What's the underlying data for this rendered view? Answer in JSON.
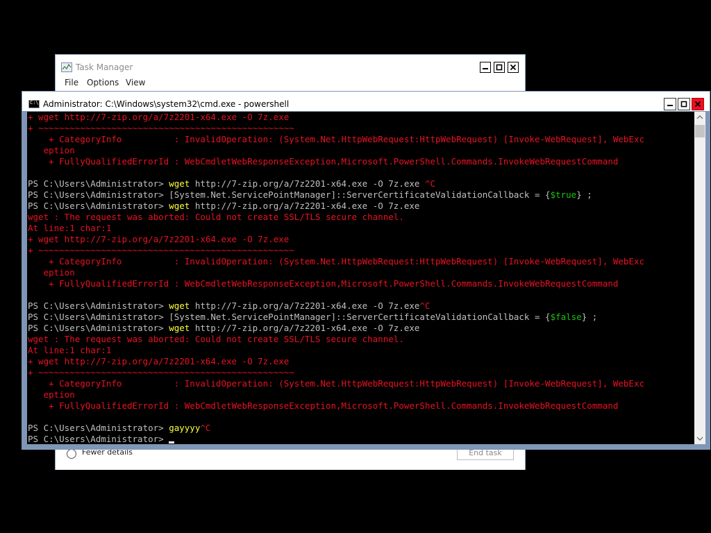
{
  "task_manager": {
    "title": "Task Manager",
    "menu": [
      "File",
      "Options",
      "View"
    ],
    "fewer_details": "Fewer details",
    "end_task": "End task"
  },
  "console": {
    "title": "Administrator: C:\\Windows\\system32\\cmd.exe - powershell",
    "icon_label": "C:\\",
    "lines": [
      [
        {
          "t": "+ wget http://7-zip.org/a/7z2201-x64.exe -O 7z.exe",
          "c": "r"
        }
      ],
      [
        {
          "t": "+ ~~~~~~~~~~~~~~~~~~~~~~~~~~~~~~~~~~~~~~~~~~~~~~~~~",
          "c": "r"
        }
      ],
      [
        {
          "t": "    + CategoryInfo          : InvalidOperation: (System.Net.HttpWebRequest:HttpWebRequest) [Invoke-WebRequest], WebExc",
          "c": "r"
        }
      ],
      [
        {
          "t": "   eption",
          "c": "r"
        }
      ],
      [
        {
          "t": "    + FullyQualifiedErrorId : WebCmdletWebResponseException,Microsoft.PowerShell.Commands.InvokeWebRequestCommand",
          "c": "r"
        }
      ],
      [
        {
          "t": "",
          "c": "w"
        }
      ],
      [
        {
          "t": "PS C:\\Users\\Administrator> ",
          "c": "w"
        },
        {
          "t": "wget",
          "c": "y"
        },
        {
          "t": " http://7-zip.org/a/7z2201-x64.exe -O 7z.exe ",
          "c": "w"
        },
        {
          "t": "^C",
          "c": "r"
        }
      ],
      [
        {
          "t": "PS C:\\Users\\Administrator> [System.Net.ServicePointManager]::ServerCertificateValidationCallback = {",
          "c": "w"
        },
        {
          "t": "$true",
          "c": "g"
        },
        {
          "t": "} ;",
          "c": "w"
        }
      ],
      [
        {
          "t": "PS C:\\Users\\Administrator> ",
          "c": "w"
        },
        {
          "t": "wget",
          "c": "y"
        },
        {
          "t": " http://7-zip.org/a/7z2201-x64.exe -O 7z.exe",
          "c": "w"
        }
      ],
      [
        {
          "t": "wget : The request was aborted: Could not create SSL/TLS secure channel.",
          "c": "r"
        }
      ],
      [
        {
          "t": "At line:1 char:1",
          "c": "r"
        }
      ],
      [
        {
          "t": "+ wget http://7-zip.org/a/7z2201-x64.exe -O 7z.exe",
          "c": "r"
        }
      ],
      [
        {
          "t": "+ ~~~~~~~~~~~~~~~~~~~~~~~~~~~~~~~~~~~~~~~~~~~~~~~~~",
          "c": "r"
        }
      ],
      [
        {
          "t": "    + CategoryInfo          : InvalidOperation: (System.Net.HttpWebRequest:HttpWebRequest) [Invoke-WebRequest], WebExc",
          "c": "r"
        }
      ],
      [
        {
          "t": "   eption",
          "c": "r"
        }
      ],
      [
        {
          "t": "    + FullyQualifiedErrorId : WebCmdletWebResponseException,Microsoft.PowerShell.Commands.InvokeWebRequestCommand",
          "c": "r"
        }
      ],
      [
        {
          "t": "",
          "c": "w"
        }
      ],
      [
        {
          "t": "PS C:\\Users\\Administrator> ",
          "c": "w"
        },
        {
          "t": "wget",
          "c": "y"
        },
        {
          "t": " http://7-zip.org/a/7z2201-x64.exe -O 7z.exe",
          "c": "w"
        },
        {
          "t": "^C",
          "c": "r"
        }
      ],
      [
        {
          "t": "PS C:\\Users\\Administrator> [System.Net.ServicePointManager]::ServerCertificateValidationCallback = {",
          "c": "w"
        },
        {
          "t": "$false",
          "c": "g"
        },
        {
          "t": "} ;",
          "c": "w"
        }
      ],
      [
        {
          "t": "PS C:\\Users\\Administrator> ",
          "c": "w"
        },
        {
          "t": "wget",
          "c": "y"
        },
        {
          "t": " http://7-zip.org/a/7z2201-x64.exe -O 7z.exe",
          "c": "w"
        }
      ],
      [
        {
          "t": "wget : The request was aborted: Could not create SSL/TLS secure channel.",
          "c": "r"
        }
      ],
      [
        {
          "t": "At line:1 char:1",
          "c": "r"
        }
      ],
      [
        {
          "t": "+ wget http://7-zip.org/a/7z2201-x64.exe -O 7z.exe",
          "c": "r"
        }
      ],
      [
        {
          "t": "+ ~~~~~~~~~~~~~~~~~~~~~~~~~~~~~~~~~~~~~~~~~~~~~~~~~",
          "c": "r"
        }
      ],
      [
        {
          "t": "    + CategoryInfo          : InvalidOperation: (System.Net.HttpWebRequest:HttpWebRequest) [Invoke-WebRequest], WebExc",
          "c": "r"
        }
      ],
      [
        {
          "t": "   eption",
          "c": "r"
        }
      ],
      [
        {
          "t": "    + FullyQualifiedErrorId : WebCmdletWebResponseException,Microsoft.PowerShell.Commands.InvokeWebRequestCommand",
          "c": "r"
        }
      ],
      [
        {
          "t": "",
          "c": "w"
        }
      ],
      [
        {
          "t": "PS C:\\Users\\Administrator> ",
          "c": "w"
        },
        {
          "t": "gayyyy",
          "c": "y"
        },
        {
          "t": "^C",
          "c": "r"
        }
      ],
      [
        {
          "t": "PS C:\\Users\\Administrator> ",
          "c": "w"
        }
      ]
    ]
  },
  "colors": {
    "default_text": "#c0c0c0",
    "command": "#ffff3c",
    "error": "#e81123",
    "boolean": "#16c60c",
    "background": "#000000",
    "close_button": "#e81123"
  },
  "icons": {
    "task_manager": "task-manager-icon",
    "console": "cmd-icon",
    "minimize": "minimize-icon",
    "maximize": "maximize-icon",
    "close": "close-icon"
  }
}
